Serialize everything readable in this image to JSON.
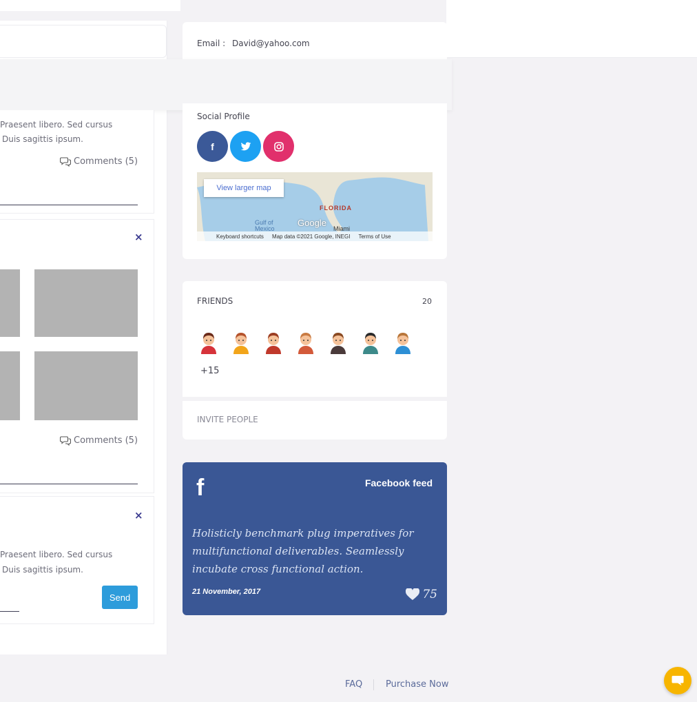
{
  "profile": {
    "email_label": "Email :",
    "email_value": "David@yahoo.com",
    "social_title": "Social Profile",
    "social": [
      {
        "icon": "facebook-icon",
        "glyph": "f",
        "color": "#3b5998"
      },
      {
        "icon": "twitter-icon",
        "glyph": "t",
        "color": "#1da1f2"
      },
      {
        "icon": "instagram-icon",
        "glyph": "◎",
        "color": "#e1306c"
      }
    ],
    "map": {
      "view_larger": "View larger map",
      "state_label": "FLORIDA",
      "gulf_label": "Gulf of Mexico",
      "city_label": "Miami",
      "google": "Google",
      "keyboard": "Keyboard shortcuts",
      "mapdata": "Map data ©2021 Google, INEGI",
      "terms": "Terms of Use"
    }
  },
  "feed": {
    "post1": {
      "text_line1": "Praesent libero. Sed cursus",
      "text_line2": "Duis sagittis ipsum.",
      "comments": "Comments (5)"
    },
    "post2": {
      "close": "×",
      "comments": "Comments (5)"
    },
    "post3": {
      "close": "×",
      "text_line1": "Praesent libero. Sed cursus",
      "text_line2": "Duis sagittis ipsum.",
      "send": "Send"
    }
  },
  "friends": {
    "title": "FRIENDS",
    "count": "20",
    "more": "+15",
    "invite": "INVITE PEOPLE",
    "avatars": [
      {
        "hair": "#6b2b1a",
        "skin": "#f5c29a",
        "shirt": "#d6333a"
      },
      {
        "hair": "#b5532c",
        "skin": "#f5c29a",
        "shirt": "#f2a51a"
      },
      {
        "hair": "#9b3d22",
        "skin": "#f5c29a",
        "shirt": "#c0392b"
      },
      {
        "hair": "#c97b43",
        "skin": "#f5c29a",
        "shirt": "#d35a3a"
      },
      {
        "hair": "#8a4a22",
        "skin": "#f5c29a",
        "shirt": "#4a3a3a"
      },
      {
        "hair": "#2b2b2b",
        "skin": "#f5c29a",
        "shirt": "#3d8a8a"
      },
      {
        "hair": "#b8763a",
        "skin": "#f5c29a",
        "shirt": "#2d8fd5"
      }
    ]
  },
  "facebook_feed": {
    "title": "Facebook feed",
    "quote": "Holisticly benchmark plug imperatives for multifunctional deliverables. Seamlessly incubate cross functional action.",
    "date": "21 November, 2017",
    "likes": "75"
  },
  "footer": {
    "faq": "FAQ",
    "purchase": "Purchase Now"
  }
}
